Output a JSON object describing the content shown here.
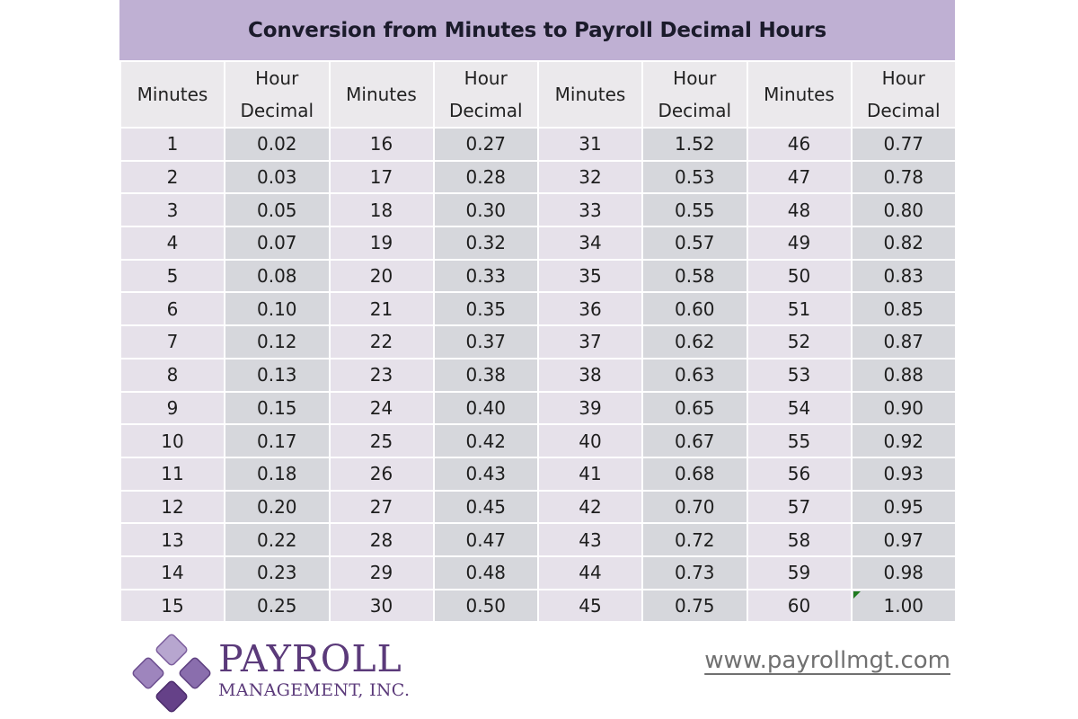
{
  "title": "Conversion from Minutes to Payroll Decimal Hours",
  "headers": {
    "minutes": "Minutes",
    "hour_decimal_line1": "Hour",
    "hour_decimal_line2": "Decimal"
  },
  "rows": [
    [
      [
        "1",
        "0.02"
      ],
      [
        "16",
        "0.27"
      ],
      [
        "31",
        "1.52"
      ],
      [
        "46",
        "0.77"
      ]
    ],
    [
      [
        "2",
        "0.03"
      ],
      [
        "17",
        "0.28"
      ],
      [
        "32",
        "0.53"
      ],
      [
        "47",
        "0.78"
      ]
    ],
    [
      [
        "3",
        "0.05"
      ],
      [
        "18",
        "0.30"
      ],
      [
        "33",
        "0.55"
      ],
      [
        "48",
        "0.80"
      ]
    ],
    [
      [
        "4",
        "0.07"
      ],
      [
        "19",
        "0.32"
      ],
      [
        "34",
        "0.57"
      ],
      [
        "49",
        "0.82"
      ]
    ],
    [
      [
        "5",
        "0.08"
      ],
      [
        "20",
        "0.33"
      ],
      [
        "35",
        "0.58"
      ],
      [
        "50",
        "0.83"
      ]
    ],
    [
      [
        "6",
        "0.10"
      ],
      [
        "21",
        "0.35"
      ],
      [
        "36",
        "0.60"
      ],
      [
        "51",
        "0.85"
      ]
    ],
    [
      [
        "7",
        "0.12"
      ],
      [
        "22",
        "0.37"
      ],
      [
        "37",
        "0.62"
      ],
      [
        "52",
        "0.87"
      ]
    ],
    [
      [
        "8",
        "0.13"
      ],
      [
        "23",
        "0.38"
      ],
      [
        "38",
        "0.63"
      ],
      [
        "53",
        "0.88"
      ]
    ],
    [
      [
        "9",
        "0.15"
      ],
      [
        "24",
        "0.40"
      ],
      [
        "39",
        "0.65"
      ],
      [
        "54",
        "0.90"
      ]
    ],
    [
      [
        "10",
        "0.17"
      ],
      [
        "25",
        "0.42"
      ],
      [
        "40",
        "0.67"
      ],
      [
        "55",
        "0.92"
      ]
    ],
    [
      [
        "11",
        "0.18"
      ],
      [
        "26",
        "0.43"
      ],
      [
        "41",
        "0.68"
      ],
      [
        "56",
        "0.93"
      ]
    ],
    [
      [
        "12",
        "0.20"
      ],
      [
        "27",
        "0.45"
      ],
      [
        "42",
        "0.70"
      ],
      [
        "57",
        "0.95"
      ]
    ],
    [
      [
        "13",
        "0.22"
      ],
      [
        "28",
        "0.47"
      ],
      [
        "43",
        "0.72"
      ],
      [
        "58",
        "0.97"
      ]
    ],
    [
      [
        "14",
        "0.23"
      ],
      [
        "29",
        "0.48"
      ],
      [
        "44",
        "0.73"
      ],
      [
        "59",
        "0.98"
      ]
    ],
    [
      [
        "15",
        "0.25"
      ],
      [
        "30",
        "0.50"
      ],
      [
        "45",
        "0.75"
      ],
      [
        "60",
        "1.00"
      ]
    ]
  ],
  "footer": {
    "logo_main": "PAYROLL",
    "logo_sub": "MANAGEMENT, INC.",
    "website": "www.payrollmgt.com"
  },
  "colors": {
    "title_bg": "#bfb0d3",
    "header_bg": "#ebe9ec",
    "minutes_cell_bg": "#e6e1ea",
    "decimal_cell_bg": "#d6d7dc",
    "brand_purple": "#5b3a7a"
  }
}
